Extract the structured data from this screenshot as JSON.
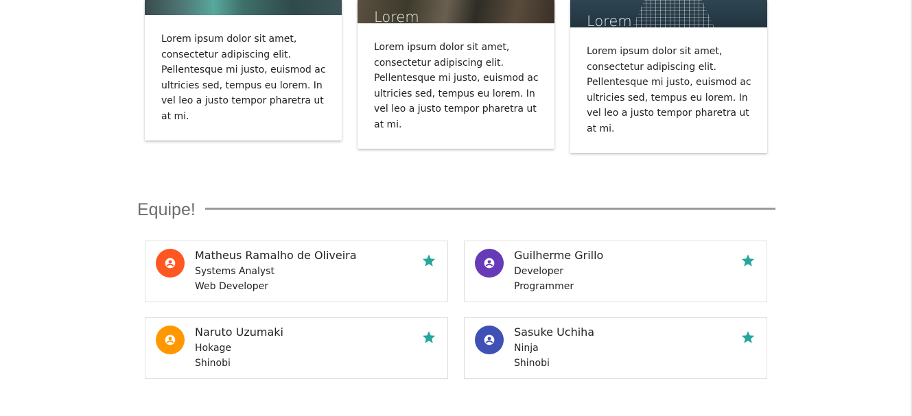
{
  "cards": [
    {
      "title": "",
      "body": "Lorem ipsum dolor sit amet, consectetur adipiscing elit. Pellentesque mi justo, euismod ac ultricies sed, tempus eu lorem. In vel leo a justo tempor pharetra ut at mi."
    },
    {
      "title": "Lorem",
      "body": "Lorem ipsum dolor sit amet, consectetur adipiscing elit. Pellentesque mi justo, euismod ac ultricies sed, tempus eu lorem. In vel leo a justo tempor pharetra ut at mi."
    },
    {
      "title": "Lorem",
      "body": "Lorem ipsum dolor sit amet, consectetur adipiscing elit. Pellentesque mi justo, euismod ac ultricies sed, tempus eu lorem. In vel leo a justo tempor pharetra ut at mi."
    }
  ],
  "team": {
    "heading": "Equipe!",
    "members": [
      {
        "name": "Matheus Ramalho de Oliveira",
        "role": "Systems Analyst",
        "sub": "Web Developer",
        "avatar_color": "#ff5722",
        "icon": "account-circle-icon"
      },
      {
        "name": "Guilherme Grillo",
        "role": "Developer",
        "sub": "Programmer",
        "avatar_color": "#673ab7",
        "icon": "account-circle-icon"
      },
      {
        "name": "Naruto Uzumaki",
        "role": "Hokage",
        "sub": "Shinobi",
        "avatar_color": "#ff9800",
        "icon": "account-circle-icon"
      },
      {
        "name": "Sasuke Uchiha",
        "role": "Ninja",
        "sub": "Shinobi",
        "avatar_color": "#3f51b5",
        "icon": "account-circle-icon"
      }
    ],
    "star_color": "#26a69a",
    "star_icon": "star-icon"
  }
}
